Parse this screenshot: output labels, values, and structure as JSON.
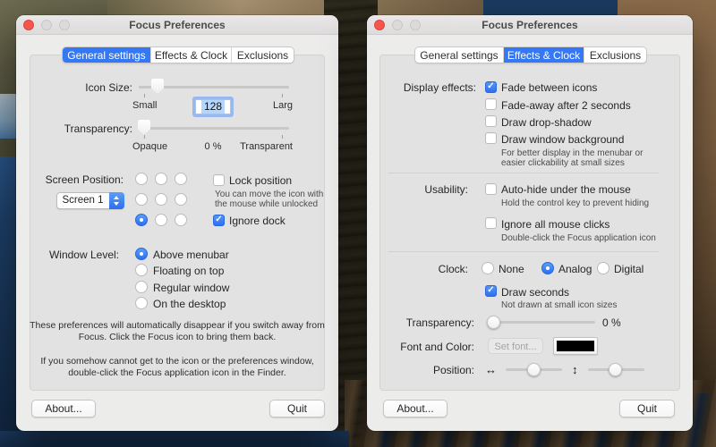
{
  "accent_color": "#3478f6",
  "control_blue": "#2d6fee",
  "left_window": {
    "title": "Focus Preferences",
    "tabs": [
      {
        "label": "General settings",
        "active": true
      },
      {
        "label": "Effects & Clock",
        "active": false
      },
      {
        "label": "Exclusions",
        "active": false
      }
    ],
    "icon_size": {
      "label": "Icon Size:",
      "min_label": "Small",
      "value": "128",
      "max_label": "Larg"
    },
    "transparency": {
      "label": "Transparency:",
      "min_label": "Opaque",
      "value": "0 %",
      "max_label": "Transparent"
    },
    "screen_position": {
      "label": "Screen Position:",
      "screen_popup": "Screen 1",
      "grid_selected": "bottom-left",
      "lock_label": "Lock position",
      "lock_checked": false,
      "lock_help_line1": "You can move the icon with",
      "lock_help_line2": "the mouse while unlocked",
      "ignore_dock_label": "Ignore dock",
      "ignore_dock_checked": true
    },
    "window_level": {
      "label": "Window Level:",
      "options": [
        "Above menubar",
        "Floating on top",
        "Regular window",
        "On the desktop"
      ],
      "selected": "Above menubar"
    },
    "note1_line1": "These preferences will automatically disappear if you switch away from",
    "note1_line2": "Focus. Click the Focus icon to bring them back.",
    "note2_line1": "If you somehow cannot get to the icon or the preferences window,",
    "note2_line2": "double-click the Focus application icon in the Finder.",
    "about_button": "About...",
    "quit_button": "Quit"
  },
  "right_window": {
    "title": "Focus Preferences",
    "tabs": [
      {
        "label": "General settings",
        "active": false
      },
      {
        "label": "Effects & Clock",
        "active": true
      },
      {
        "label": "Exclusions",
        "active": false
      }
    ],
    "display_effects": {
      "label": "Display effects:",
      "items": [
        {
          "label": "Fade between icons",
          "checked": true
        },
        {
          "label": "Fade-away after 2 seconds",
          "checked": false
        },
        {
          "label": "Draw drop-shadow",
          "checked": false
        },
        {
          "label": "Draw window background",
          "checked": false,
          "help_line1": "For better display in the menubar or",
          "help_line2": "easier clickability at small sizes"
        }
      ]
    },
    "usability": {
      "label": "Usability:",
      "items": [
        {
          "label": "Auto-hide under the mouse",
          "checked": false,
          "help": "Hold the control key to prevent hiding"
        },
        {
          "label": "Ignore all mouse clicks",
          "checked": false,
          "help": "Double-click the Focus application icon"
        }
      ]
    },
    "clock": {
      "label": "Clock:",
      "options": [
        "None",
        "Analog",
        "Digital"
      ],
      "selected": "Analog",
      "draw_seconds": {
        "label": "Draw seconds",
        "checked": true,
        "help": "Not drawn at small icon sizes"
      }
    },
    "transparency": {
      "label": "Transparency:",
      "value": "0 %"
    },
    "font_color": {
      "label": "Font and Color:",
      "set_font_button": "Set font...",
      "color_swatch": "#000000"
    },
    "position": {
      "label": "Position:",
      "h_icon": "↔",
      "v_icon": "↕"
    },
    "about_button": "About...",
    "quit_button": "Quit"
  }
}
